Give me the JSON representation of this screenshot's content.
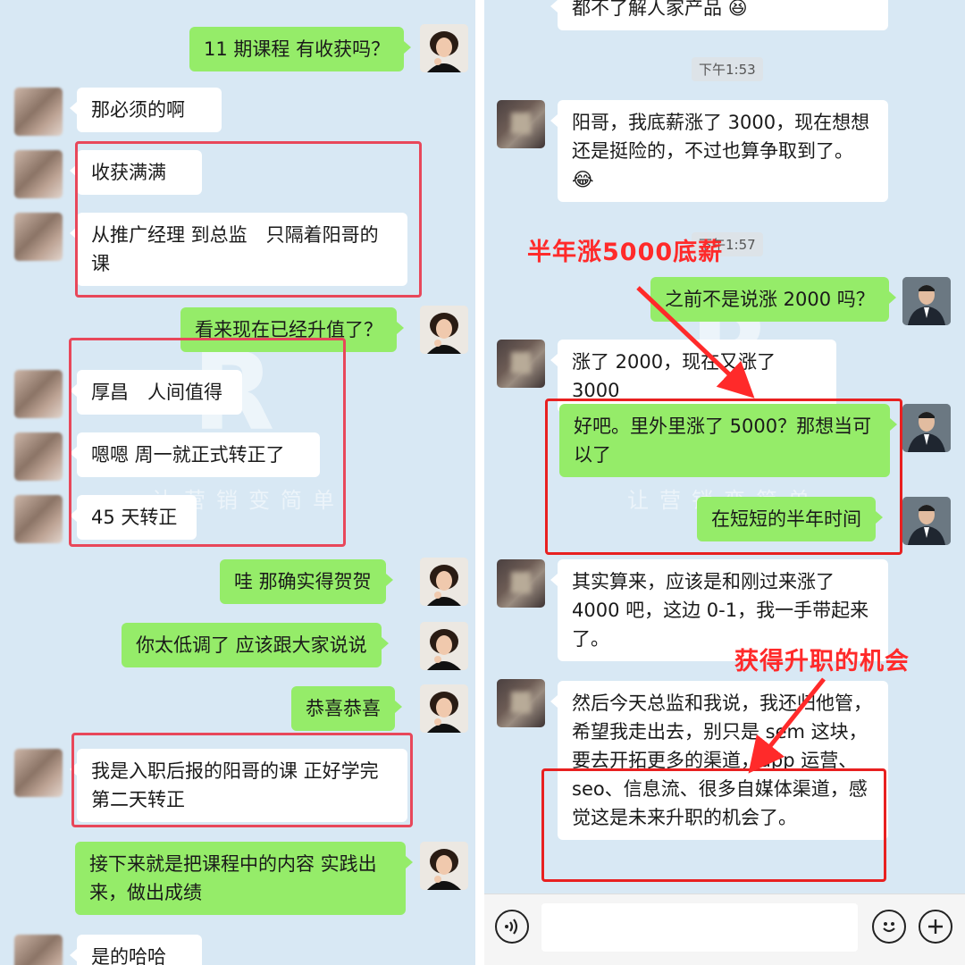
{
  "left_chat": {
    "messages": [
      {
        "side": "out",
        "text": "11 期课程 有收获吗？"
      },
      {
        "side": "in",
        "text": "那必须的啊"
      },
      {
        "side": "in",
        "text": "收获满满"
      },
      {
        "side": "in",
        "text": "从推广经理 到总监　只隔着阳哥的课"
      },
      {
        "side": "out",
        "text": "看来现在已经升值了？"
      },
      {
        "side": "in",
        "text": "厚昌　人间值得"
      },
      {
        "side": "in",
        "text": "嗯嗯  周一就正式转正了"
      },
      {
        "side": "in",
        "text": "45 天转正"
      },
      {
        "side": "out",
        "text": "哇  那确实得贺贺"
      },
      {
        "side": "out",
        "text": "你太低调了 应该跟大家说说"
      },
      {
        "side": "out",
        "text": "恭喜恭喜"
      },
      {
        "side": "in",
        "text": "我是入职后报的阳哥的课  正好学完第二天转正"
      },
      {
        "side": "out",
        "text": "接下来就是把课程中的内容 实践出来，做出成绩"
      },
      {
        "side": "in",
        "text": "是的哈哈"
      }
    ]
  },
  "right_chat": {
    "top_partial": "都不了解人家产品",
    "timestamps": [
      "下午1:53",
      "下午1:57"
    ],
    "messages": [
      {
        "side": "in",
        "text": "阳哥，我底薪涨了 3000，现在想想还是挺险的，不过也算争取到了。"
      },
      {
        "side": "out",
        "text": "之前不是说涨 2000 吗？"
      },
      {
        "side": "in",
        "text": "涨了 2000，现在又涨了 3000"
      },
      {
        "side": "out",
        "text": "好吧。里外里涨了 5000？那想当可以了"
      },
      {
        "side": "out",
        "text": "在短短的半年时间"
      },
      {
        "side": "in",
        "text": "其实算来，应该是和刚过来涨了 4000 吧，这边 0-1，我一手带起来了。"
      },
      {
        "side": "in",
        "text": "然后今天总监和我说，我还归他管，希望我走出去，别只是 sem 这块，要去开拓更多的渠道，app 运营、seo、信息流、很多自媒体渠道，感觉这是未来升职的机会了。"
      }
    ],
    "annotations": [
      "半年涨5000底薪",
      "获得升职的机会"
    ]
  },
  "watermark": {
    "left_slogan": "让营销变简单",
    "right_slogan": "让营销变简单"
  },
  "icons": {
    "voice": "voice-icon",
    "emoji": "emoji-icon",
    "plus": "plus-icon"
  },
  "colors": {
    "bg": "#d8e8f4",
    "out_bubble": "#95ec69",
    "in_bubble": "#ffffff",
    "highlight": "#e8475a",
    "annotation": "#ff2a2a"
  }
}
